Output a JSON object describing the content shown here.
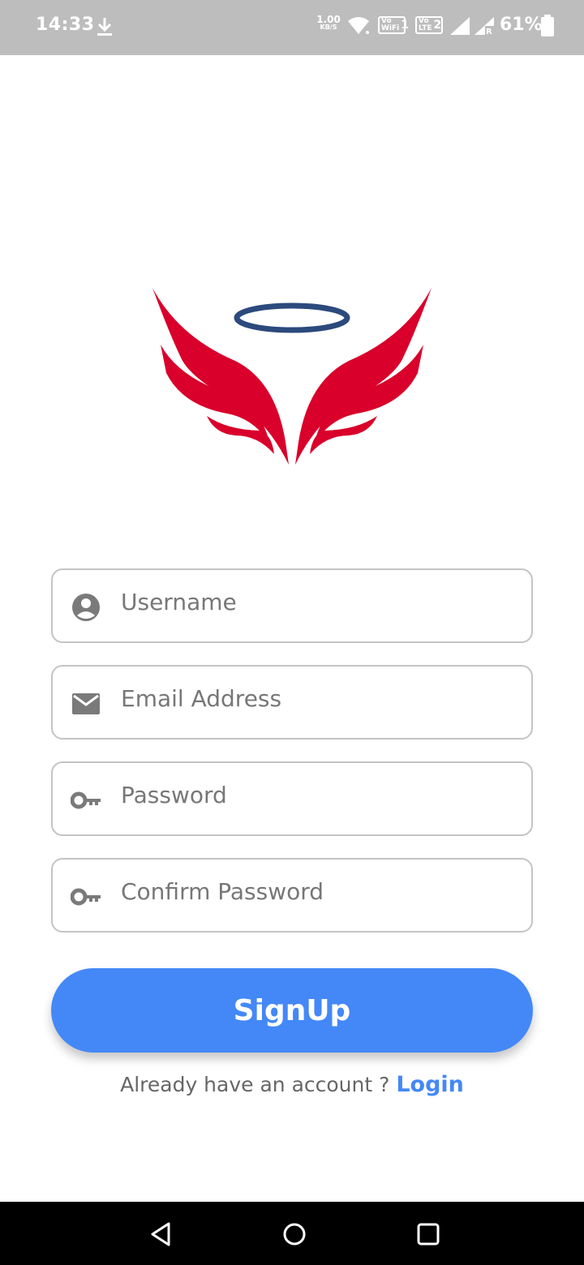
{
  "status_bar": {
    "time": "14:33",
    "net_speed_value": "1.00",
    "net_speed_unit": "KB/S",
    "vo_wifi_label_top": "Vo",
    "vo_wifi_label_bottom": "WiFi",
    "vo_wifi_num": "1",
    "vo_lte_label_top": "Vo",
    "vo_lte_label_bottom": "LTE",
    "vo_lte_num": "2",
    "battery_percent": "61%",
    "icons": [
      "download-icon",
      "wifi-icon",
      "signal-icon",
      "signal-roaming-icon",
      "battery-icon"
    ]
  },
  "logo": {
    "name": "angel-wings-halo-logo",
    "wing_color": "#d9002b",
    "halo_color": "#2c4a7c"
  },
  "form": {
    "username": {
      "placeholder": "Username",
      "icon": "user-icon"
    },
    "email": {
      "placeholder": "Email Address",
      "icon": "mail-icon"
    },
    "password": {
      "placeholder": "Password",
      "icon": "key-icon"
    },
    "confirm_password": {
      "placeholder": "Confirm Password",
      "icon": "key-icon"
    },
    "signup_label": "SignUp"
  },
  "footer": {
    "prompt": "Already have an account ? ",
    "login_label": "Login"
  },
  "colors": {
    "accent": "#4488f7",
    "status_bar": "#bdbdbd",
    "field_border": "#c4c4c4",
    "icon_gray": "#7a7a7a"
  },
  "nav_bar": {
    "icons": [
      "back-icon",
      "home-icon",
      "recents-icon"
    ]
  }
}
